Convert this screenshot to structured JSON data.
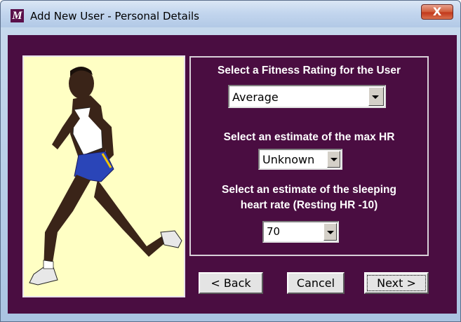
{
  "window": {
    "title": "Add New User - Personal Details",
    "app_icon_glyph": "M",
    "close_glyph": "X"
  },
  "fitness": {
    "label": "Select a Fitness Rating for the User",
    "value": "Average"
  },
  "max_hr": {
    "label": "Select an estimate of the  max HR",
    "value": "Unknown"
  },
  "sleeping_hr": {
    "label_line1": "Select an estimate of the sleeping",
    "label_line2": "heart rate (Resting HR -10)",
    "value": "70"
  },
  "buttons": {
    "back": "< Back",
    "cancel": "Cancel",
    "next": "Next >"
  },
  "colors": {
    "client_bg": "#4a0d41",
    "picture_bg": "#ffffc4",
    "label_text": "#ffffff"
  },
  "icons": {
    "app": "app-logo-icon",
    "close": "close-icon",
    "dropdown": "chevron-down-icon",
    "picture": "runner-illustration"
  }
}
